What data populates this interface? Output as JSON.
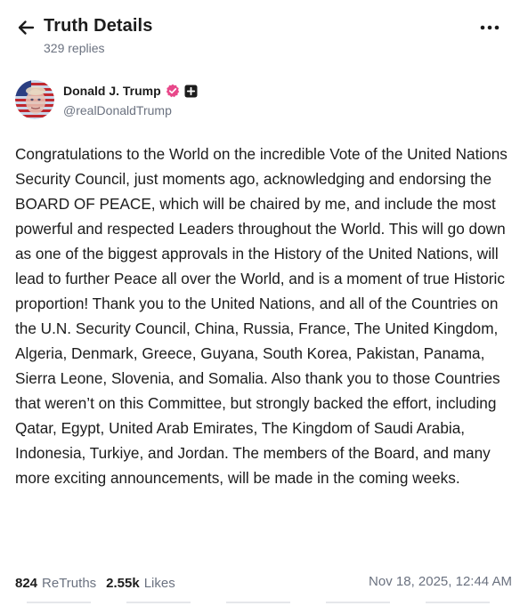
{
  "header": {
    "title": "Truth Details",
    "replies": "329 replies",
    "back_icon": "arrow-left-icon",
    "more_icon": "more-horizontal-icon"
  },
  "author": {
    "name": "Donald J. Trump",
    "handle": "@realDonaldTrump",
    "verified_icon": "verified-badge-icon",
    "verified_color": "#e8488a",
    "plus_icon": "plus-badge-icon"
  },
  "post": {
    "text": "Congratulations to the World on the incredible Vote of the United Nations Security Council, just moments ago, acknowledging and endorsing the BOARD OF PEACE, which will be chaired by me, and include the most powerful and respected Leaders throughout the World. This will go down as one of the biggest approvals in the History of the United Nations, will lead to further Peace all over the World, and is a moment of true Historic proportion! Thank you to the United Nations, and all of the Countries on the U.N. Security Council, China, Russia, France, The United Kingdom, Algeria, Denmark, Greece, Guyana, South Korea, Pakistan, Panama, Sierra Leone, Slovenia, and Somalia. Also thank you to those Countries that weren’t on this Committee, but strongly backed the effort, including Qatar, Egypt, United Arab Emirates, The Kingdom of Saudi Arabia, Indonesia, Turkiye, and Jordan. The members of the Board, and many more exciting announcements, will be made in the coming weeks."
  },
  "stats": {
    "retruths_count": "824",
    "retruths_label": "ReTruths",
    "likes_count": "2.55k",
    "likes_label": "Likes",
    "timestamp": "Nov 18, 2025, 12:44 AM"
  },
  "colors": {
    "text": "#1c1c1c",
    "muted": "#6b7280",
    "background": "#ffffff"
  }
}
